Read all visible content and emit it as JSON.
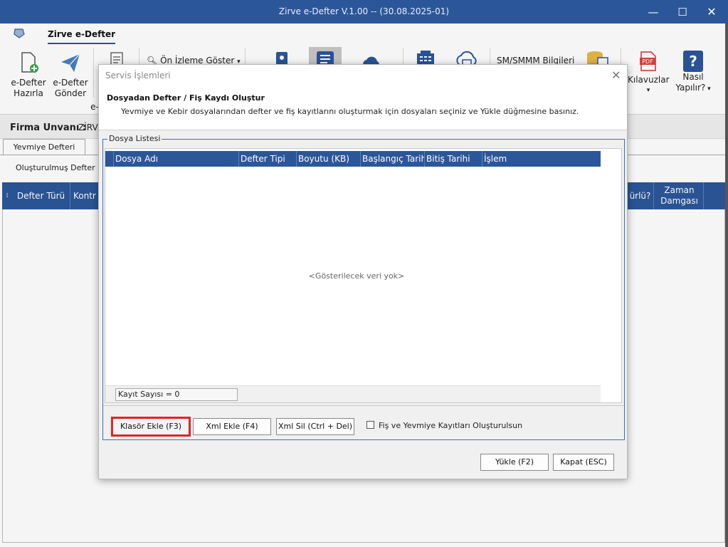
{
  "window": {
    "title": "Zirve e-Defter V.1.00  -- (30.08.2025-01)",
    "minimize": "—",
    "maximize": "☐",
    "close": "✕"
  },
  "ribbon": {
    "tab": "Zirve e-Defter",
    "buttons": [
      {
        "line1": "e-Defter",
        "line2": "Hazırla"
      },
      {
        "line1": "e-Defter",
        "line2": "Gönder"
      }
    ],
    "partial_e": "e-",
    "onizleme": "Ön İzleme Göster",
    "smmm": "SM/SMMM Bilgileri",
    "kilavuzlar": "Kılavuzlar",
    "nasil_1": "Nasıl",
    "nasil_2": "Yapılır?",
    "pdf_text": "PDF",
    "question": "?"
  },
  "firma": {
    "label": "Firma Unvanı :",
    "value": "ZİRV"
  },
  "tabs": {
    "yevmiye": "Yevmiye Defteri"
  },
  "olusturulmus": "Oluşturulmuş Defter Kay",
  "grid": {
    "defter_turu": "Defter Türü",
    "kontr": "Kontr",
    "murlu": "ürlü?",
    "zaman_1": "Zaman",
    "zaman_2": "Damgası"
  },
  "dialog": {
    "title": "Servis İşlemleri",
    "heading": "Dosyadan Defter / Fiş Kaydı Oluştur",
    "description": "Yevmiye ve Kebir dosyalarından defter ve fiş kayıtlarını oluşturmak için dosyaları seçiniz ve Yükle düğmesine basınız.",
    "group": "Dosya Listesi",
    "columns": [
      "Dosya Adı",
      "Defter Tipi",
      "Boyutu (KB)",
      "Başlangıç Tarihi",
      "Bitiş Tarihi",
      "İşlem"
    ],
    "empty": "<Gösterilecek veri yok>",
    "record_count": "Kayıt Sayısı = 0",
    "btn_klasor": "Klasör Ekle (F3)",
    "btn_xml_ekle": "Xml Ekle (F4)",
    "btn_xml_sil": "Xml Sil (Ctrl + Del)",
    "checkbox": "Fiş ve Yevmiye Kayıtları Oluşturulsun",
    "btn_yukle": "Yükle (F2)",
    "btn_kapat": "Kapat (ESC)"
  },
  "colors": {
    "titlebar": "#2b579a",
    "header": "#2b579a",
    "highlight": "#e02424"
  }
}
